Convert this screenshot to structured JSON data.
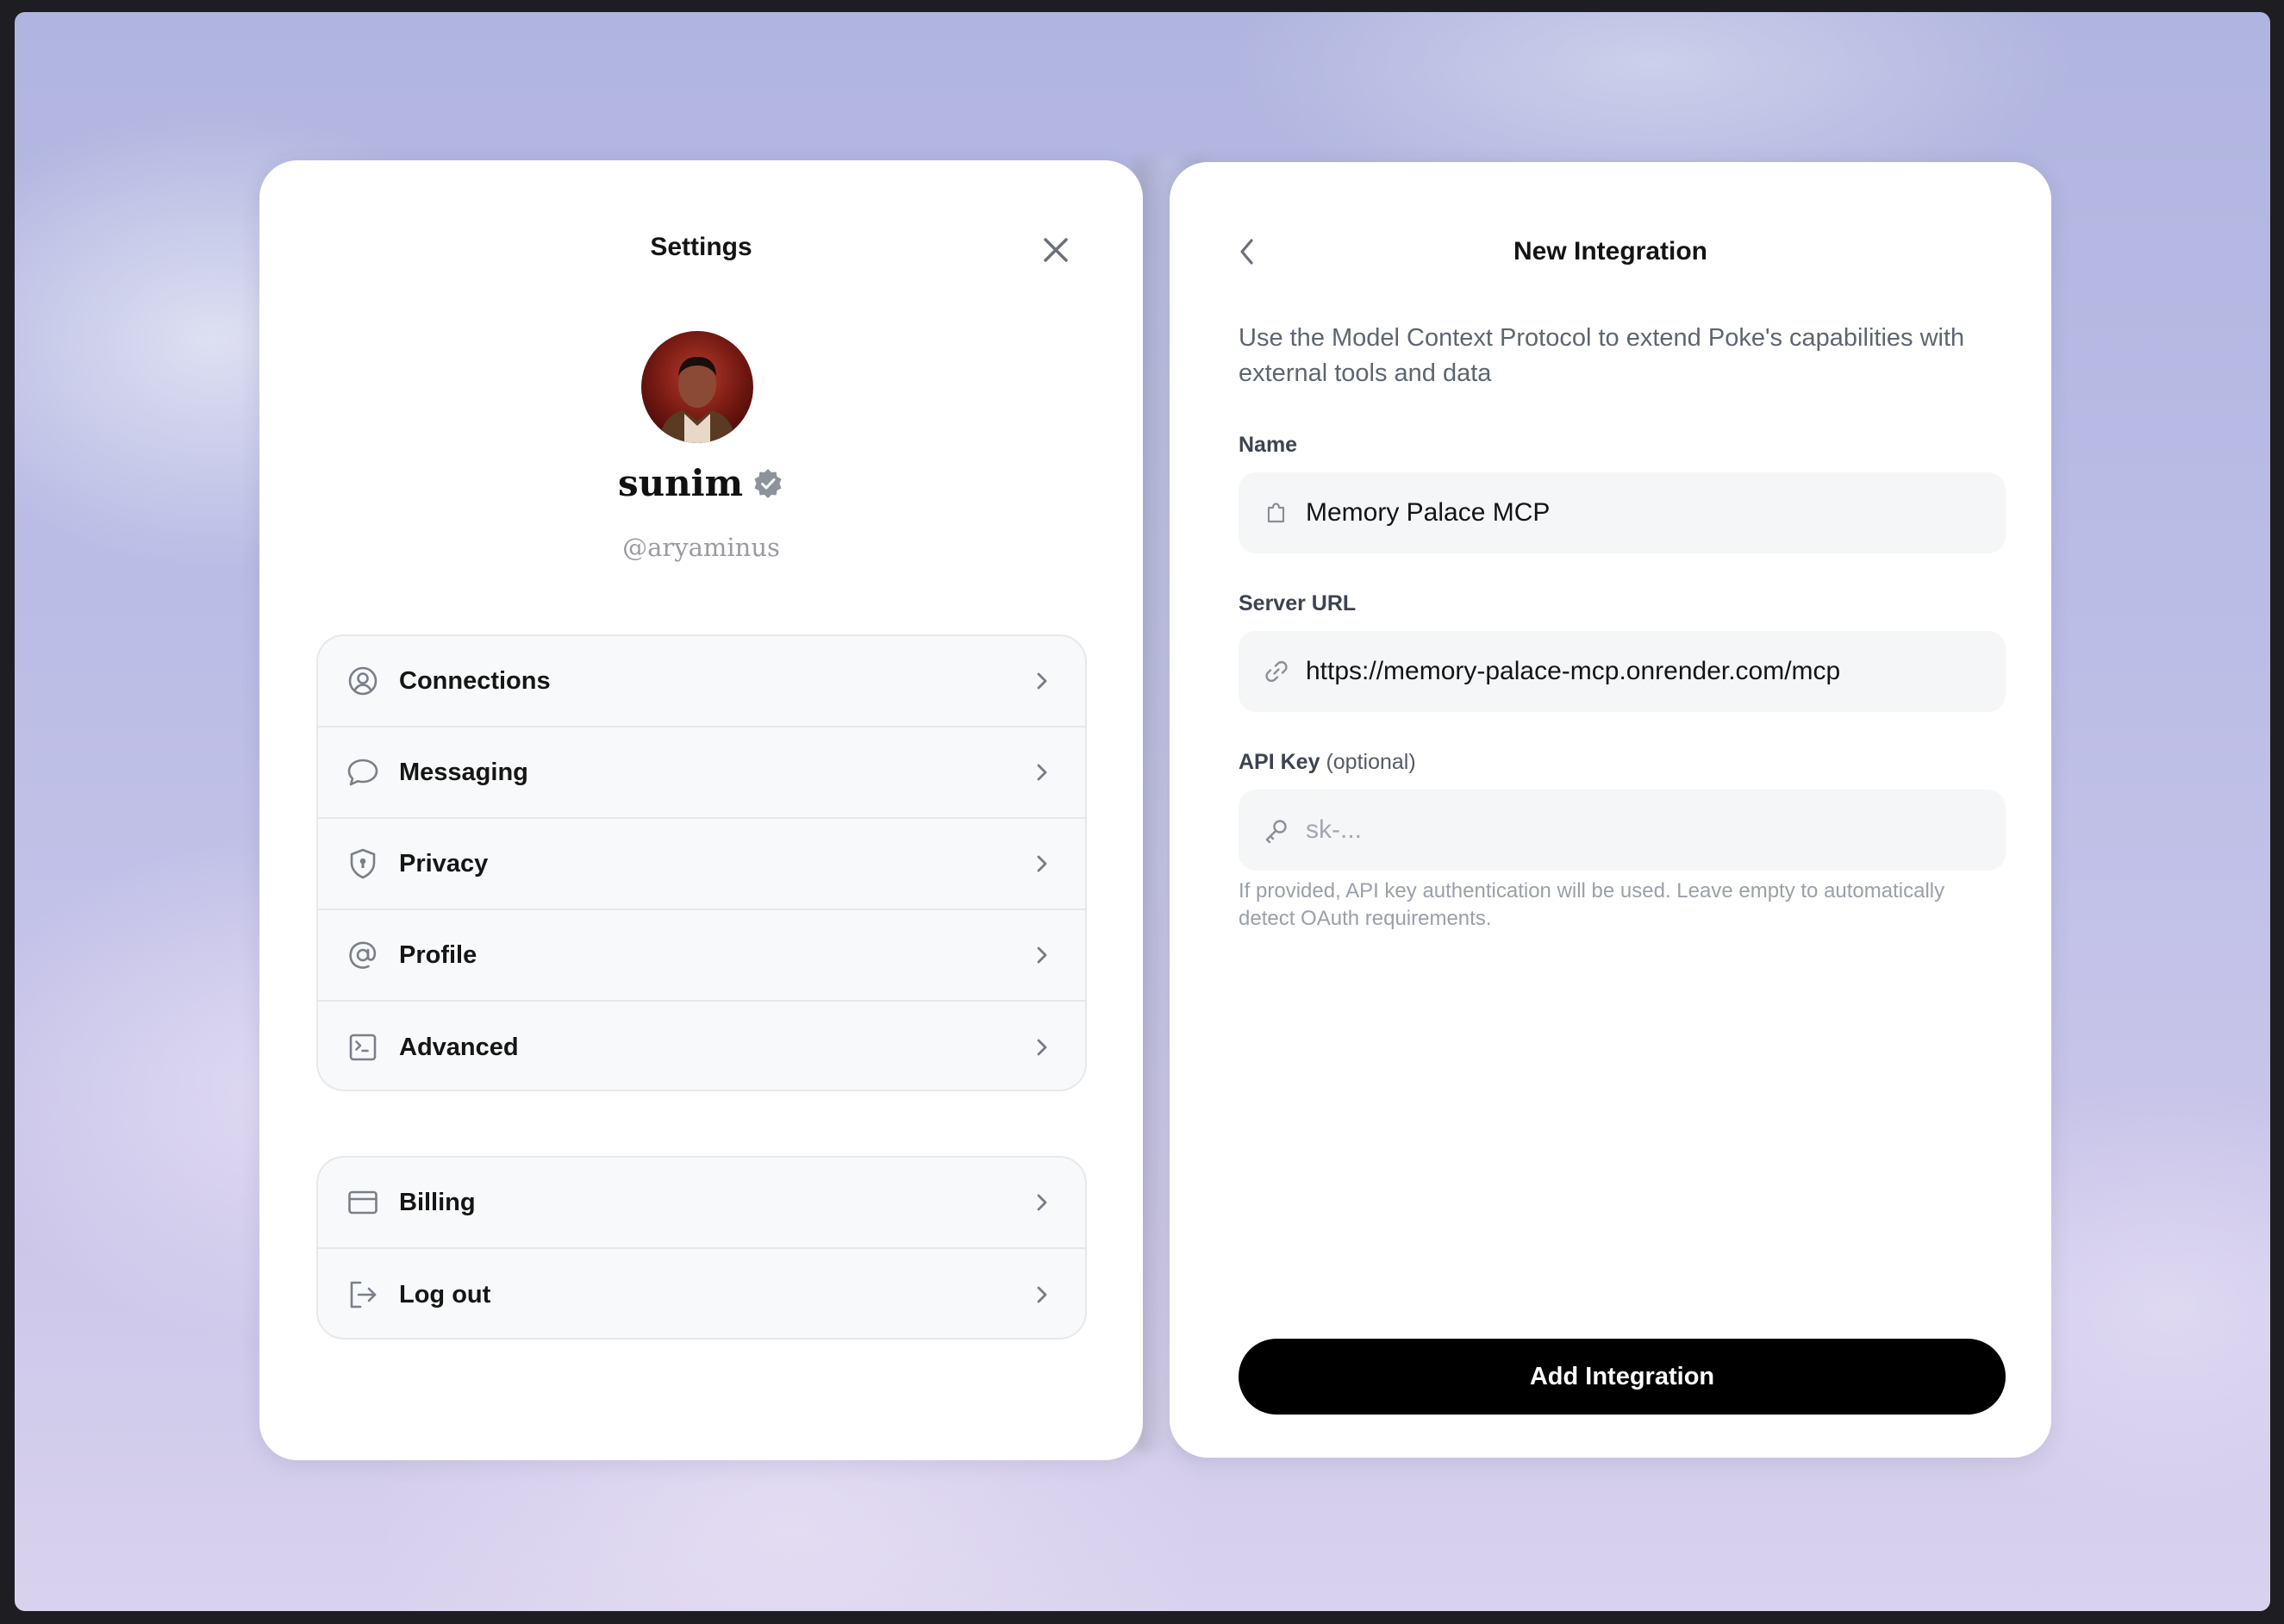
{
  "settings": {
    "title": "Settings",
    "profile": {
      "name": "sunim",
      "handle": "@aryaminus"
    },
    "menu_primary": [
      {
        "label": "Connections",
        "icon": "user-circle-icon"
      },
      {
        "label": "Messaging",
        "icon": "chat-bubble-icon"
      },
      {
        "label": "Privacy",
        "icon": "shield-icon"
      },
      {
        "label": "Profile",
        "icon": "at-sign-icon"
      },
      {
        "label": "Advanced",
        "icon": "terminal-icon"
      }
    ],
    "menu_secondary": [
      {
        "label": "Billing",
        "icon": "credit-card-icon"
      },
      {
        "label": "Log out",
        "icon": "logout-icon"
      }
    ]
  },
  "integration": {
    "title": "New Integration",
    "description": "Use the Model Context Protocol to extend Poke's capabilities with external tools and data",
    "name_label": "Name",
    "name_value": "Memory Palace MCP",
    "url_label": "Server URL",
    "url_value": "https://memory-palace-mcp.onrender.com/mcp",
    "api_label": "API Key",
    "api_label_optional": "(optional)",
    "api_placeholder": "sk-...",
    "hint": "If provided, API key authentication will be used. Leave empty to automatically detect OAuth requirements.",
    "submit_label": "Add Integration"
  },
  "colors": {
    "accent": "#000000",
    "text_primary": "#141414",
    "text_muted": "#9aa0aa",
    "verified_badge": "#8e929a"
  }
}
